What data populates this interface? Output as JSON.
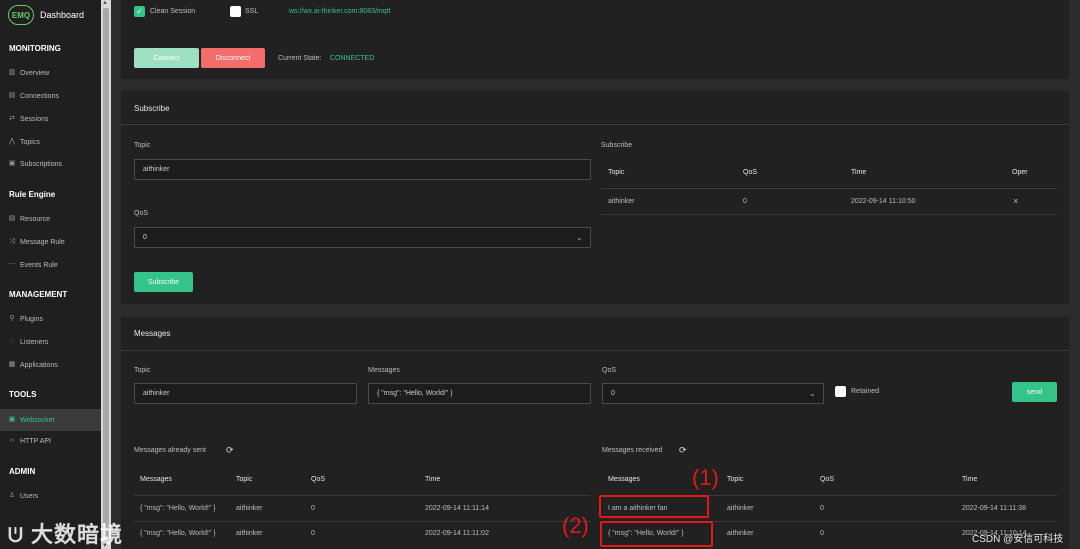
{
  "brand": {
    "logo": "EMQ",
    "title": "Dashboard"
  },
  "sidebar": {
    "monitoring": "MONITORING",
    "monitoring_items": [
      {
        "label": "Overview",
        "icon": "chart-icon"
      },
      {
        "label": "Connections",
        "icon": "connections-icon"
      },
      {
        "label": "Sessions",
        "icon": "sessions-icon"
      },
      {
        "label": "Topics",
        "icon": "topics-icon"
      },
      {
        "label": "Subscriptions",
        "icon": "subscriptions-icon"
      }
    ],
    "rule_engine": "Rule Engine",
    "rule_items": [
      {
        "label": "Resource",
        "icon": "resource-icon"
      },
      {
        "label": "Message Rule",
        "icon": "shuffle-icon"
      },
      {
        "label": "Events Rule",
        "icon": "events-icon"
      }
    ],
    "management": "MANAGEMENT",
    "management_items": [
      {
        "label": "Plugins",
        "icon": "plug-icon"
      },
      {
        "label": "Listeners",
        "icon": "listener-icon"
      },
      {
        "label": "Applications",
        "icon": "applications-icon"
      }
    ],
    "tools": "TOOLS",
    "tools_items": [
      {
        "label": "Websocket",
        "icon": "websocket-icon",
        "active": true
      },
      {
        "label": "HTTP API",
        "icon": "code-icon"
      }
    ],
    "admin": "ADMIN",
    "admin_items": [
      {
        "label": "Users",
        "icon": "user-icon"
      }
    ]
  },
  "connection": {
    "clean_session": "Clean Session",
    "ssl": "SSL",
    "url": "ws://wx.ai-thinker.com:8083/mqtt",
    "connect": "Connect",
    "disconnect": "Disconnect",
    "state_label": "Current State:",
    "state_value": "CONNECTED"
  },
  "subscribe": {
    "title": "Subscribe",
    "topic_label": "Topic",
    "topic_value": "aithinker",
    "qos_label": "QoS",
    "qos_value": "0",
    "button": "Subscribe",
    "table_label": "Subscribe",
    "headers": [
      "Topic",
      "QoS",
      "Time",
      "Oper"
    ],
    "row": {
      "topic": "aithinker",
      "qos": "0",
      "time": "2022-09-14 11:10:50",
      "oper": "×"
    }
  },
  "messages": {
    "title": "Messages",
    "topic_label": "Topic",
    "topic_value": "aithinker",
    "msg_label": "Messages",
    "msg_value": "{ \"msg\": \"Hello, World!\" }",
    "qos_label": "QoS",
    "qos_value": "0",
    "retained": "Retained",
    "send": "send",
    "sent_label": "Messages already sent",
    "received_label": "Messages received",
    "headers": [
      "Messages",
      "Topic",
      "QoS",
      "Time"
    ],
    "sent": [
      {
        "msg": "{ \"msg\": \"Hello, World!\" }",
        "topic": "aithinker",
        "qos": "0",
        "time": "2022-09-14 11:11:14"
      },
      {
        "msg": "{ \"msg\": \"Hello, World!\" }",
        "topic": "aithinker",
        "qos": "0",
        "time": "2022-09-14 11:11:02"
      }
    ],
    "received": [
      {
        "msg": "I am a aithinker fan",
        "topic": "aithinker",
        "qos": "0",
        "time": "2022-09-14 11:11:38"
      },
      {
        "msg": "{ \"msg\": \"Hello, World!\" }",
        "topic": "aithinker",
        "qos": "0",
        "time": "2022-09-14 11:10:14"
      }
    ]
  },
  "annotations": {
    "a1": "(1)",
    "a2": "(2)"
  },
  "watermark": {
    "left": "大数暗境",
    "right": "CSDN @安信可科技"
  },
  "colors": {
    "accent": "#34c388",
    "danger": "#f56c6c",
    "annotation": "#e0191a"
  }
}
